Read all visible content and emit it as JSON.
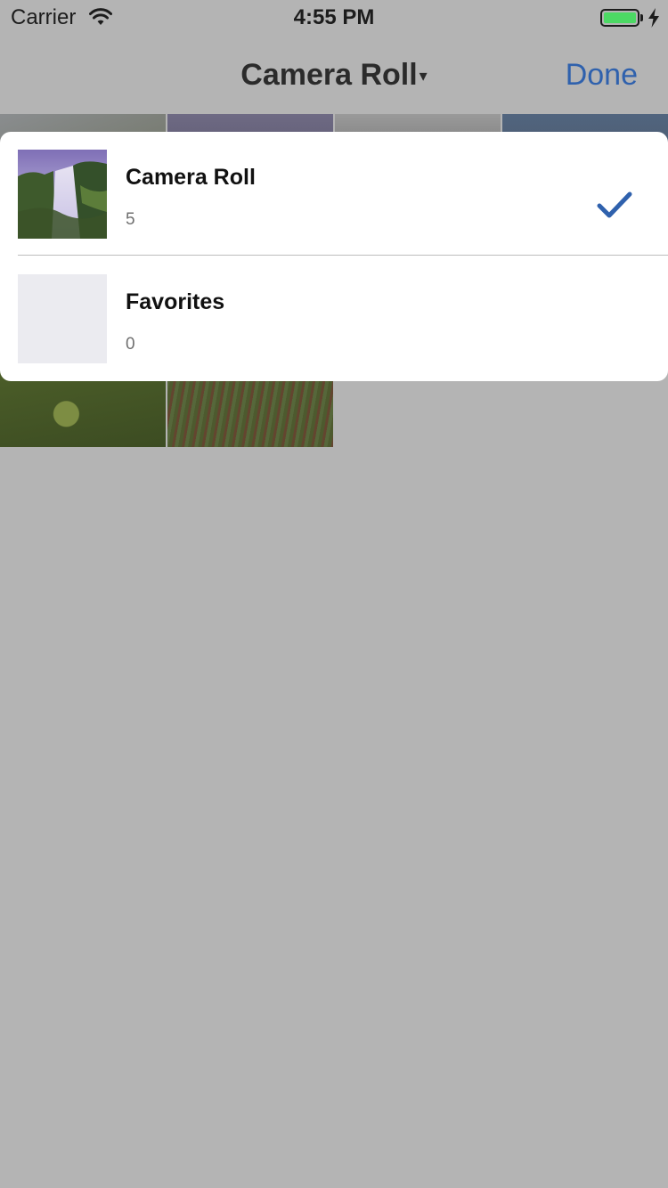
{
  "status_bar": {
    "carrier": "Carrier",
    "time": "4:55 PM",
    "wifi_icon": "wifi-icon",
    "battery_icon": "battery-icon",
    "battery_level": 1.0,
    "charging_icon": "lightning-bolt-icon",
    "battery_color": "#4cd964"
  },
  "nav": {
    "title": "Camera Roll",
    "title_caret": "▾",
    "done_label": "Done",
    "accent_color": "#2f61ad"
  },
  "photo_grid": {
    "photo_count": 6
  },
  "albums": [
    {
      "name": "Camera Roll",
      "count": "5",
      "thumbnail": "waterfall-photo",
      "selected": true
    },
    {
      "name": "Favorites",
      "count": "0",
      "thumbnail": "empty-placeholder",
      "selected": false
    }
  ],
  "icons": {
    "selected_check": "checkmark-icon"
  }
}
